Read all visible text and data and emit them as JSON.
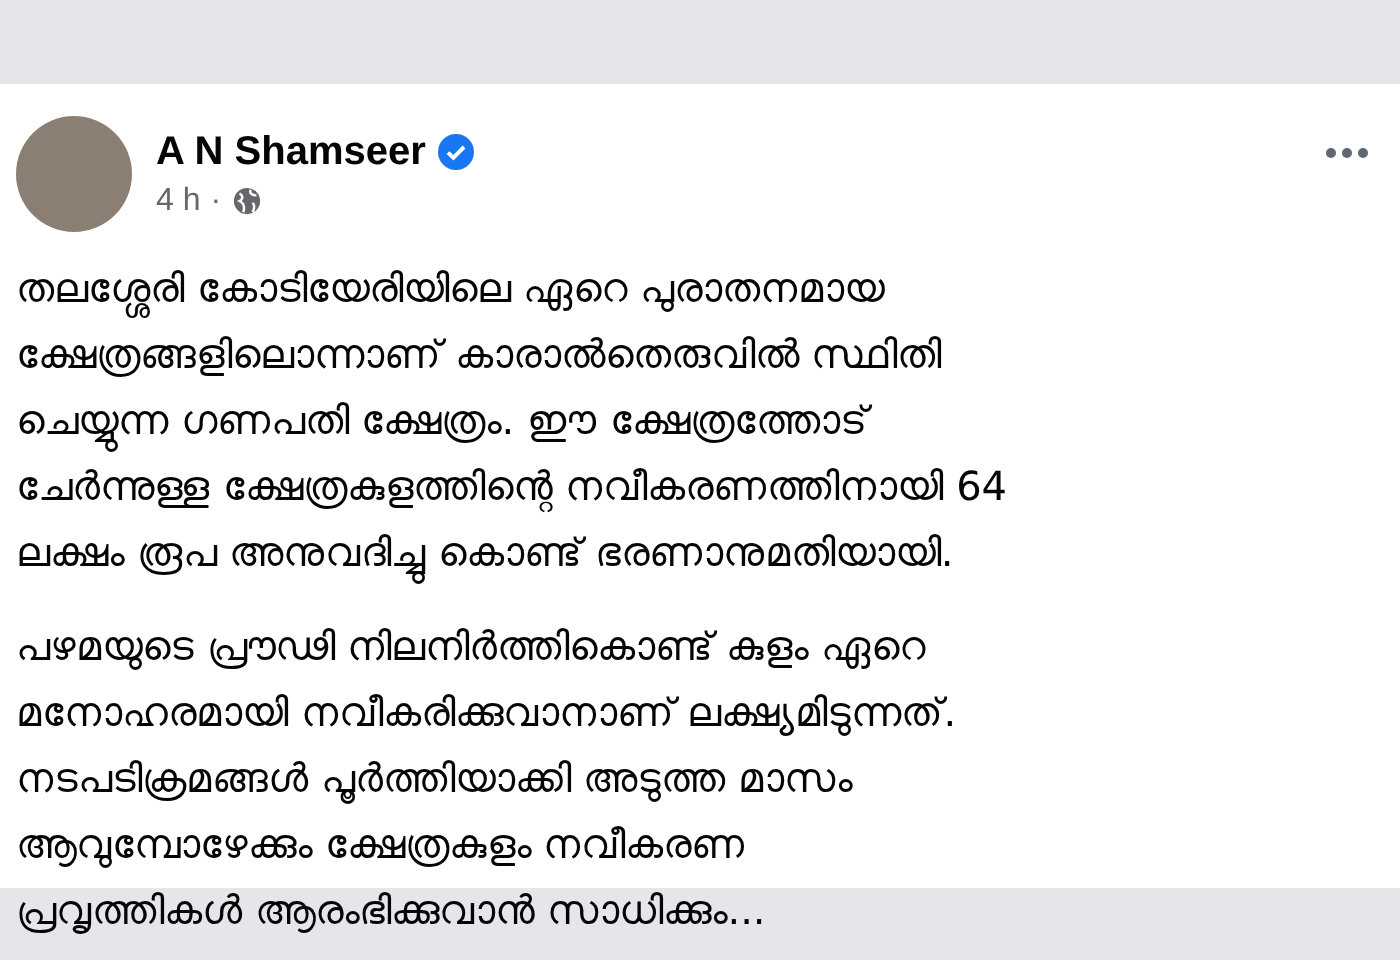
{
  "post": {
    "author": "A N Shamseer",
    "verified": true,
    "time": "4 h",
    "separator": "·",
    "paragraphs": [
      [
        "തലശ്ശേരി കോടിയേരിയിലെ ഏറെ പുരാതനമായ",
        "ക്ഷേത്രങ്ങളിലൊന്നാണ് കാരാൽതെരുവിൽ സ്ഥിതി",
        "ചെയ്യുന്ന ഗണപതി ക്ഷേത്രം. ഈ ക്ഷേത്രത്തോട്",
        "ചേർന്നുള്ള ക്ഷേത്രകുളത്തിന്റെ നവീകരണത്തിനായി 64",
        "ലക്ഷം രൂപ അനുവദിച്ചു കൊണ്ട് ഭരണാനുമതിയായി."
      ],
      [
        "പഴമയുടെ പ്രൗഢി നിലനിർത്തികൊണ്ട് കുളം ഏറെ",
        "മനോഹരമായി നവീകരിക്കുവാനാണ് ലക്ഷ്യമിടുന്നത്.",
        "നടപടിക്രമങ്ങൾ പൂർത്തിയാക്കി അടുത്ത മാസം",
        "ആവുമ്പോഴേക്കും ക്ഷേത്രകുളം നവീകരണ",
        "പ്രവൃത്തികൾ ആരംഭിക്കുവാൻ സാധിക്കും..."
      ]
    ]
  }
}
